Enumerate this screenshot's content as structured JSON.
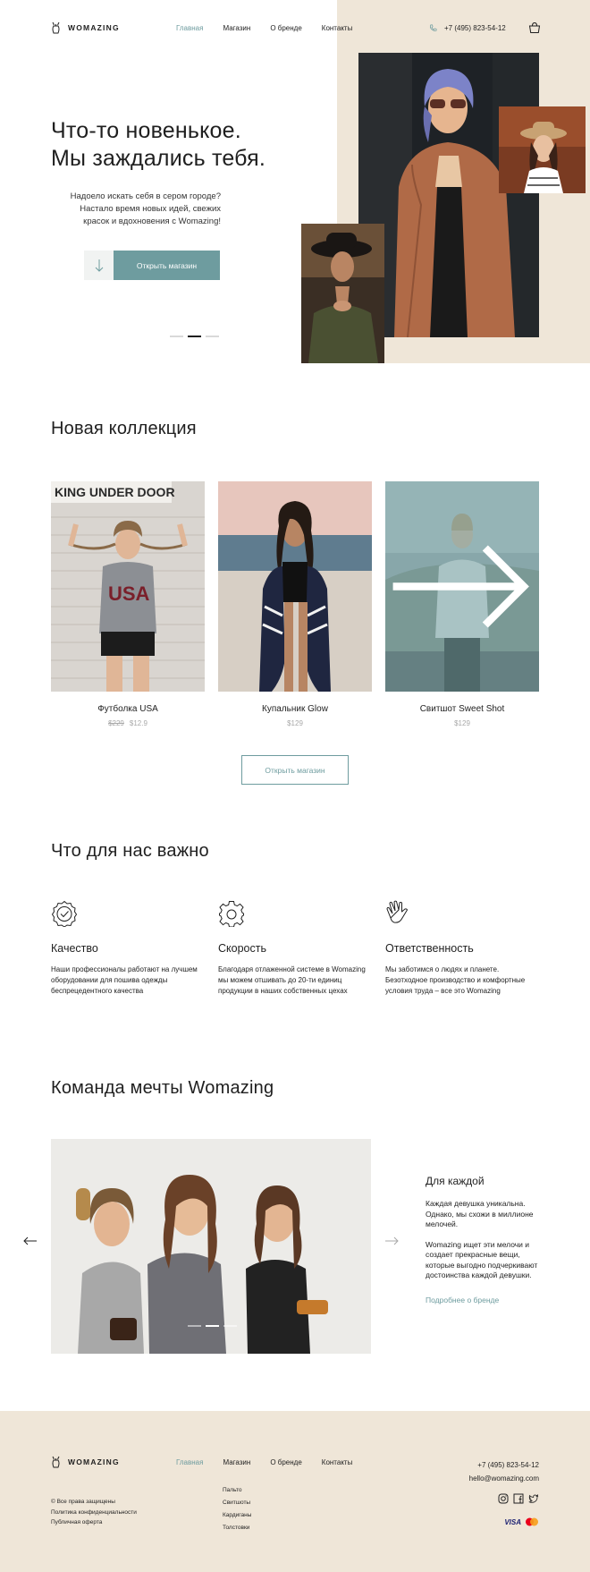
{
  "brand": "WOMAZING",
  "nav": [
    {
      "label": "Главная",
      "active": true
    },
    {
      "label": "Магазин",
      "active": false
    },
    {
      "label": "О бренде",
      "active": false
    },
    {
      "label": "Контакты",
      "active": false
    }
  ],
  "phone": "+7 (495) 823-54-12",
  "hero": {
    "title_line1": "Что-то новенькое.",
    "title_line2": "Мы заждались тебя.",
    "text_line1": "Надоело искать себя в сером городе?",
    "text_line2": "Настало время новых идей, свежих",
    "text_line3": "красок и вдохновения с Womazing!",
    "button": "Открыть магазин",
    "slides": 3,
    "active_slide": 2
  },
  "collection": {
    "title": "Новая коллекция",
    "items": [
      {
        "name": "Футболка USA",
        "old_price": "$229",
        "price": "$12.9"
      },
      {
        "name": "Купальник Glow",
        "old_price": "",
        "price": "$129"
      },
      {
        "name": "Свитшот Sweet Shot",
        "old_price": "",
        "price": "$129"
      }
    ],
    "button": "Открыть магазин",
    "sign_text": "KING UNDER DOOR",
    "shirt_text": "USA"
  },
  "values": {
    "title": "Что для нас важно",
    "items": [
      {
        "title": "Качество",
        "icon": "quality-badge-icon",
        "text": "Наши профессионалы работают на лучшем оборудовании для пошива одежды беспрецедентного качества"
      },
      {
        "title": "Скорость",
        "icon": "gear-icon",
        "text": "Благодаря отлаженной системе в Womazing мы можем отшивать до 20-ти единиц продукции в наших собственных цехах"
      },
      {
        "title": "Ответственность",
        "icon": "hand-icon",
        "text": "Мы заботимся о людях и планете. Безотходное производство и комфортные условия труда – все это Womazing"
      }
    ]
  },
  "team": {
    "title": "Команда мечты Womazing",
    "subtitle": "Для каждой",
    "p1": "Каждая девушка уникальна. Однако, мы схожи в миллионе мелочей.",
    "p2": "Womazing ищет эти мелочи и создает прекрасные вещи, которые выгодно подчеркивают достоинства каждой девушки.",
    "more": "Подробнее о бренде",
    "slides": 3,
    "active_slide": 2
  },
  "footer": {
    "nav": [
      {
        "label": "Главная",
        "active": true
      },
      {
        "label": "Магазин",
        "active": false
      },
      {
        "label": "О бренде",
        "active": false
      },
      {
        "label": "Контакты",
        "active": false
      }
    ],
    "shop_links": [
      "Пальто",
      "Свитшоты",
      "Кардиганы",
      "Толстовки"
    ],
    "legal": [
      "© Все права защищены",
      "Политика конфиденциальности",
      "Публичная оферта"
    ],
    "phone": "+7 (495) 823-54-12",
    "email": "hello@womazing.com",
    "social": [
      "instagram-icon",
      "facebook-icon",
      "twitter-icon"
    ],
    "payment": "VISA"
  },
  "colors": {
    "accent": "#6e9c9f",
    "beige": "#efe6d8",
    "text": "#1f1f1f"
  }
}
